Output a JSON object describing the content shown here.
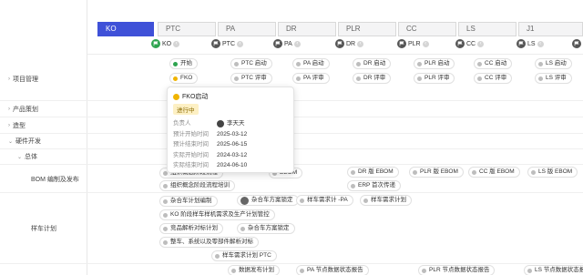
{
  "stages": [
    {
      "label": "KO",
      "active": true
    },
    {
      "label": "PTC",
      "active": false
    },
    {
      "label": "PA",
      "active": false
    },
    {
      "label": "DR",
      "active": false
    },
    {
      "label": "PLR",
      "active": false
    },
    {
      "label": "CC",
      "active": false
    },
    {
      "label": "LS",
      "active": false
    },
    {
      "label": "J1",
      "active": false
    }
  ],
  "milestones": [
    "KO",
    "PTC",
    "PA",
    "DR",
    "PLR",
    "CC",
    "LS",
    "J1"
  ],
  "rows": {
    "project_mgmt": "项目管理",
    "product_plan": "产品策划",
    "styling": "造型",
    "hardware": "硬件开发",
    "overall": "总体",
    "bom": "BOM 编制及发布",
    "prototype": "样车计划"
  },
  "project_items": {
    "start": "开始",
    "fko": "FKO",
    "ptc_start": "PTC 启动",
    "ptc_review": "PTC 评审",
    "pa_start": "PA 启动",
    "pa_review": "PA 评审",
    "dr_start": "DR 启动",
    "dr_review": "DR 评审",
    "plr_start": "PLR 启动",
    "plr_review": "PLR 评审",
    "cc_start": "CC 启动",
    "cc_review": "CC 评审",
    "ls_start": "LS 启动",
    "ls_review": "LS 评审"
  },
  "bom_items": {
    "a": "组织概念阶段流程",
    "b": "EBOM",
    "c": "DR 版 EBOM",
    "d": "PLR 版 EBOM",
    "e": "CC 版 EBOM",
    "f": "LS 版 EBOM",
    "g": "组织概念阶段流程培训",
    "h": "ERP 首次传递"
  },
  "proto_items": {
    "a": "杂合车计划编制",
    "b": "杂合车方案锁定",
    "c": "样车需求计 -PA",
    "d": "样车需求计划",
    "e": "KO 阶段样车样机需求及生产计划管控",
    "f": "竞品解析对标计划",
    "g": "杂合车方案锁定",
    "h": "整车、系统以及零部件解析对标",
    "i": "样车需求计划 PTC"
  },
  "bottom_items": {
    "a": "数据发布计划",
    "b": "PA 节点数据状态报告",
    "c": "PLR 节点数据状态报告",
    "d": "LS 节点数据状态报"
  },
  "popup": {
    "title": "FKO启动",
    "status": "进行中",
    "owner_label": "负责人",
    "owner": "李天天",
    "plan_start_label": "预计开始时间",
    "plan_start": "2025-03-12",
    "plan_end_label": "预计结束时间",
    "plan_end": "2025-06-15",
    "act_start_label": "实际开始时间",
    "act_start": "2024-03-12",
    "act_end_label": "实际结束时间",
    "act_end": "2024-06-10"
  }
}
